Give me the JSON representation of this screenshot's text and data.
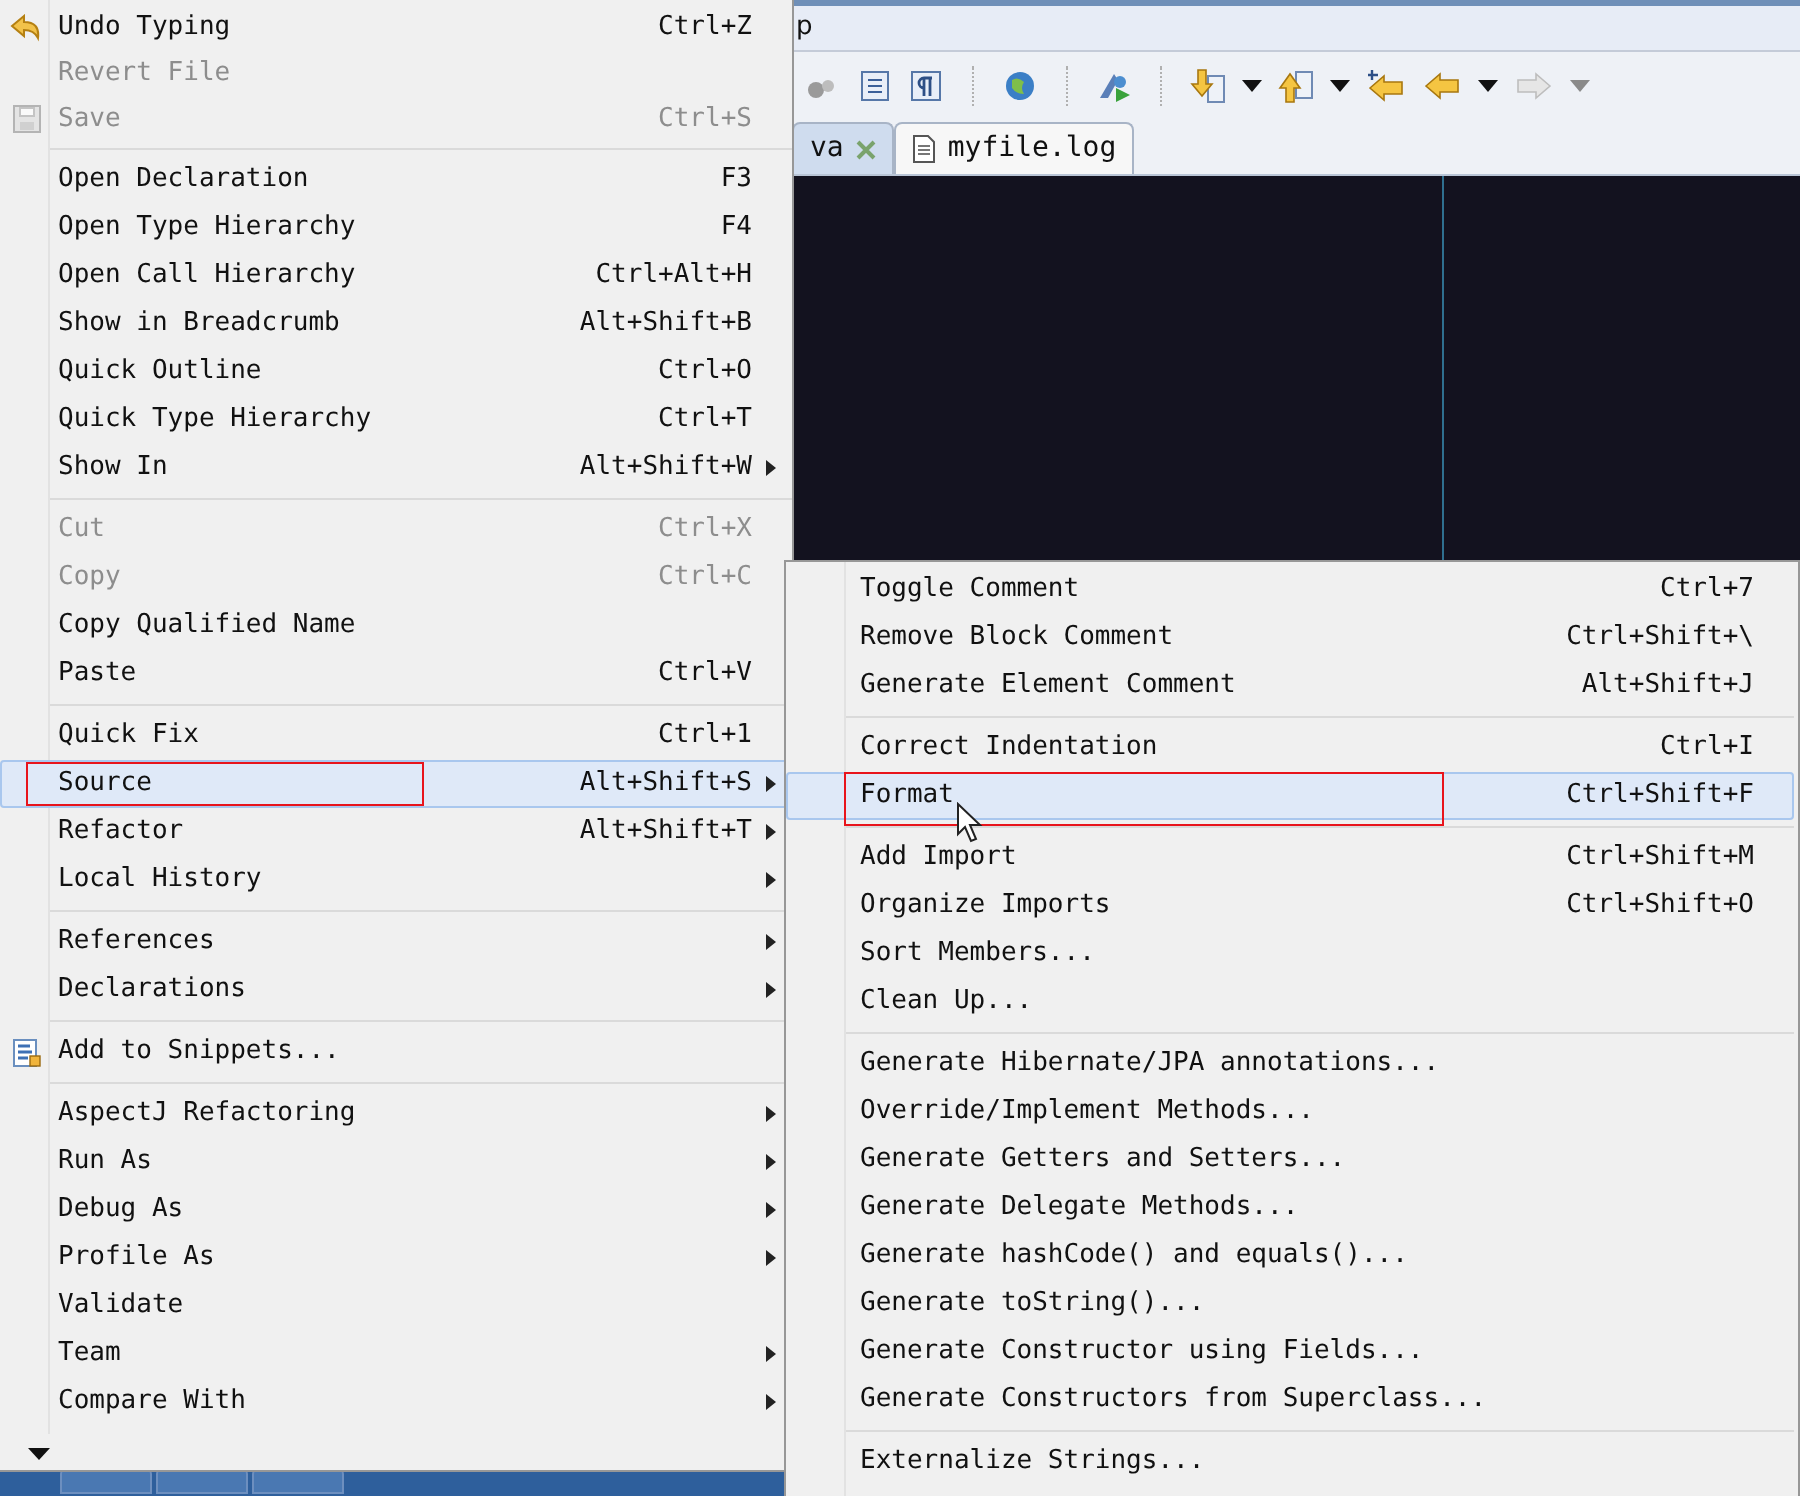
{
  "ide": {
    "menu_bar_text": "p",
    "tabs": [
      {
        "label": "va",
        "selected": true
      },
      {
        "label": "myfile.log",
        "selected": false
      }
    ]
  },
  "context_menu": {
    "groups": [
      [
        {
          "label": "Undo Typing",
          "shortcut": "Ctrl+Z",
          "disabled": false,
          "submenu": false,
          "selected": false
        },
        {
          "label": "Revert File",
          "disabled": true,
          "submenu": false,
          "selected": false
        },
        {
          "label": "Save",
          "shortcut": "Ctrl+S",
          "disabled": true,
          "submenu": false,
          "selected": false
        }
      ],
      [
        {
          "label": "Open Declaration",
          "shortcut": "F3",
          "disabled": false,
          "submenu": false,
          "selected": false
        },
        {
          "label": "Open Type Hierarchy",
          "shortcut": "F4",
          "disabled": false,
          "submenu": false,
          "selected": false
        },
        {
          "label": "Open Call Hierarchy",
          "shortcut": "Ctrl+Alt+H",
          "disabled": false,
          "submenu": false,
          "selected": false
        },
        {
          "label": "Show in Breadcrumb",
          "shortcut": "Alt+Shift+B",
          "disabled": false,
          "submenu": false,
          "selected": false
        },
        {
          "label": "Quick Outline",
          "shortcut": "Ctrl+O",
          "disabled": false,
          "submenu": false,
          "selected": false
        },
        {
          "label": "Quick Type Hierarchy",
          "shortcut": "Ctrl+T",
          "disabled": false,
          "submenu": false,
          "selected": false
        },
        {
          "label": "Show In",
          "shortcut": "Alt+Shift+W",
          "disabled": false,
          "submenu": true,
          "selected": false
        }
      ],
      [
        {
          "label": "Cut",
          "shortcut": "Ctrl+X",
          "disabled": true,
          "submenu": false,
          "selected": false
        },
        {
          "label": "Copy",
          "shortcut": "Ctrl+C",
          "disabled": true,
          "submenu": false,
          "selected": false
        },
        {
          "label": "Copy Qualified Name",
          "disabled": false,
          "submenu": false,
          "selected": false
        },
        {
          "label": "Paste",
          "shortcut": "Ctrl+V",
          "disabled": false,
          "submenu": false,
          "selected": false
        }
      ],
      [
        {
          "label": "Quick Fix",
          "shortcut": "Ctrl+1",
          "disabled": false,
          "submenu": false,
          "selected": false
        },
        {
          "label": "Source",
          "shortcut": "Alt+Shift+S",
          "disabled": false,
          "submenu": true,
          "selected": true
        },
        {
          "label": "Refactor",
          "shortcut": "Alt+Shift+T",
          "disabled": false,
          "submenu": true,
          "selected": false
        },
        {
          "label": "Local History",
          "disabled": false,
          "submenu": true,
          "selected": false
        }
      ],
      [
        {
          "label": "References",
          "disabled": false,
          "submenu": true,
          "selected": false
        },
        {
          "label": "Declarations",
          "disabled": false,
          "submenu": true,
          "selected": false
        }
      ],
      [
        {
          "label": "Add to Snippets...",
          "disabled": false,
          "submenu": false,
          "selected": false
        }
      ],
      [
        {
          "label": "AspectJ Refactoring",
          "disabled": false,
          "submenu": true,
          "selected": false
        },
        {
          "label": "Run As",
          "disabled": false,
          "submenu": true,
          "selected": false
        },
        {
          "label": "Debug As",
          "disabled": false,
          "submenu": true,
          "selected": false
        },
        {
          "label": "Profile As",
          "disabled": false,
          "submenu": true,
          "selected": false
        },
        {
          "label": "Validate",
          "disabled": false,
          "submenu": false,
          "selected": false
        },
        {
          "label": "Team",
          "disabled": false,
          "submenu": true,
          "selected": false
        },
        {
          "label": "Compare With",
          "disabled": false,
          "submenu": true,
          "selected": false
        }
      ]
    ]
  },
  "source_submenu": {
    "groups": [
      [
        {
          "label": "Toggle Comment",
          "shortcut": "Ctrl+7",
          "selected": false
        },
        {
          "label": "Remove Block Comment",
          "shortcut": "Ctrl+Shift+\\",
          "selected": false
        },
        {
          "label": "Generate Element Comment",
          "shortcut": "Alt+Shift+J",
          "selected": false
        }
      ],
      [
        {
          "label": "Correct Indentation",
          "shortcut": "Ctrl+I",
          "selected": false
        },
        {
          "label": "Format",
          "shortcut": "Ctrl+Shift+F",
          "selected": true
        }
      ],
      [
        {
          "label": "Add Import",
          "shortcut": "Ctrl+Shift+M",
          "selected": false
        },
        {
          "label": "Organize Imports",
          "shortcut": "Ctrl+Shift+O",
          "selected": false
        },
        {
          "label": "Sort Members...",
          "selected": false
        },
        {
          "label": "Clean Up...",
          "selected": false
        }
      ],
      [
        {
          "label": "Generate Hibernate/JPA annotations...",
          "selected": false
        },
        {
          "label": "Override/Implement Methods...",
          "selected": false
        },
        {
          "label": "Generate Getters and Setters...",
          "selected": false
        },
        {
          "label": "Generate Delegate Methods...",
          "selected": false
        },
        {
          "label": "Generate hashCode() and equals()...",
          "selected": false
        },
        {
          "label": "Generate toString()...",
          "selected": false
        },
        {
          "label": "Generate Constructor using Fields...",
          "selected": false
        },
        {
          "label": "Generate Constructors from Superclass...",
          "selected": false
        }
      ],
      [
        {
          "label": "Externalize Strings...",
          "selected": false
        }
      ]
    ]
  }
}
